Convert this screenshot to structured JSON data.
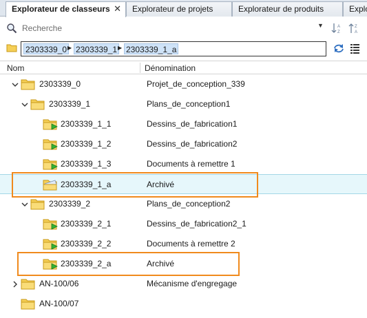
{
  "tabs": [
    {
      "label": "Explorateur de classeurs",
      "active": true,
      "closable": true
    },
    {
      "label": "Explorateur de projets",
      "active": false
    },
    {
      "label": "Explorateur de produits",
      "active": false
    },
    {
      "label": "Explo",
      "active": false
    }
  ],
  "search": {
    "placeholder": "Recherche"
  },
  "path": {
    "crumbs": [
      "2303339_0",
      "2303339_1",
      "2303339_1_a"
    ]
  },
  "columns": {
    "name": "Nom",
    "description": "Dénomination"
  },
  "tree": [
    {
      "name": "2303339_0",
      "desc": "Projet_de_conception_339",
      "level": 0,
      "expander": "open",
      "icon": "folder-icon"
    },
    {
      "name": "2303339_1",
      "desc": "Plans_de_conception1",
      "level": 1,
      "expander": "open",
      "icon": "folder-icon"
    },
    {
      "name": "2303339_1_1",
      "desc": "Dessins_de_fabrication1",
      "level": 2,
      "expander": "none",
      "icon": "workbook-folder-icon"
    },
    {
      "name": "2303339_1_2",
      "desc": "Dessins_de_fabrication2",
      "level": 2,
      "expander": "none",
      "icon": "workbook-folder-icon"
    },
    {
      "name": "2303339_1_3",
      "desc": "Documents à remettre 1",
      "level": 2,
      "expander": "none",
      "icon": "workbook-folder-icon"
    },
    {
      "name": "2303339_1_a",
      "desc": "Archivé",
      "level": 2,
      "expander": "none",
      "icon": "archived-folder-icon",
      "selected": true
    },
    {
      "name": "2303339_2",
      "desc": "Plans_de_conception2",
      "level": 1,
      "expander": "open",
      "icon": "folder-icon"
    },
    {
      "name": "2303339_2_1",
      "desc": "Dessins_de_fabrication2_1",
      "level": 2,
      "expander": "none",
      "icon": "workbook-folder-icon"
    },
    {
      "name": "2303339_2_2",
      "desc": "Documents à remettre 2",
      "level": 2,
      "expander": "none",
      "icon": "workbook-folder-icon"
    },
    {
      "name": "2303339_2_a",
      "desc": "Archivé",
      "level": 2,
      "expander": "none",
      "icon": "workbook-folder-icon"
    },
    {
      "name": "AN-100/06",
      "desc": "Mécanisme d'engregage",
      "level": 0,
      "expander": "closed",
      "icon": "folder-icon"
    },
    {
      "name": "AN-100/07",
      "desc": "",
      "level": 0,
      "expander": "none",
      "icon": "folder-icon"
    }
  ],
  "colors": {
    "highlight": "#f08a1c",
    "selection": "#e6f7fb",
    "folder": "#f5cf57",
    "crumb": "#cfe3f8"
  }
}
